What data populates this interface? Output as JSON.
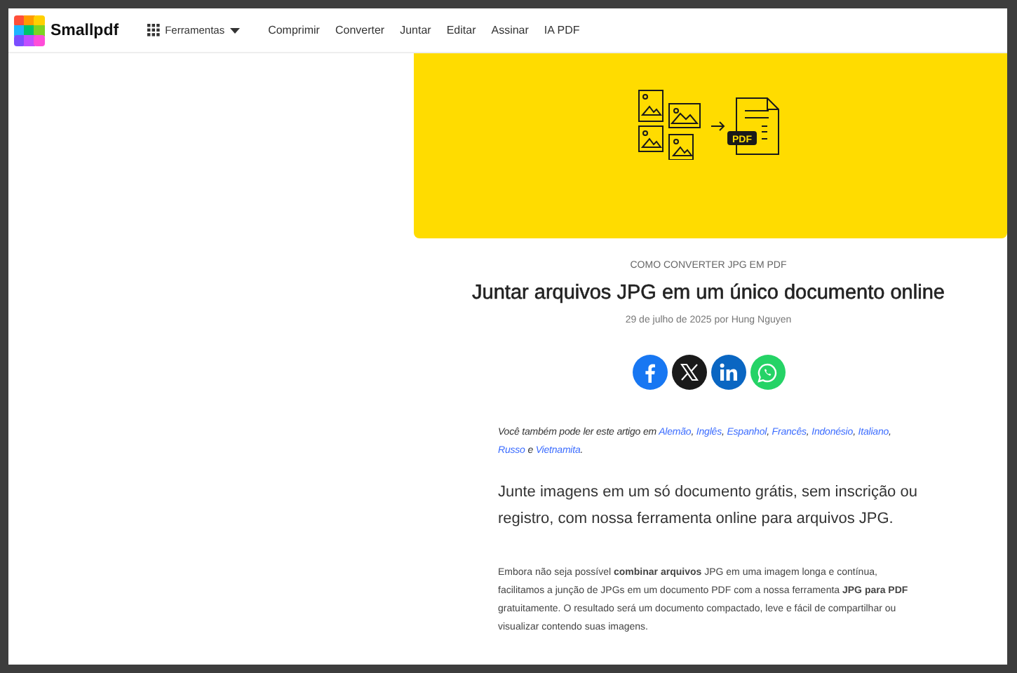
{
  "nav": {
    "logo": "Smallpdf",
    "tools_menu": "Ferramentas",
    "links": [
      "Comprimir",
      "Converter",
      "Juntar",
      "Editar",
      "Assinar",
      "IA PDF"
    ]
  },
  "banner": {
    "badge": "PDF"
  },
  "article": {
    "eyebrow": "COMO CONVERTER JPG EM PDF",
    "title": "Juntar arquivos JPG em um único documento online",
    "byline": "29 de julho de 2025 por Hung Nguyen",
    "share": [
      {
        "kind": "facebook",
        "color": "#1877f2"
      },
      {
        "kind": "x",
        "color": "#1a1a1a"
      },
      {
        "kind": "linkedin",
        "color": "#0a66c2"
      },
      {
        "kind": "whatsapp",
        "color": "#25d366"
      }
    ],
    "languages": [
      {
        "kind": "text",
        "text": "Você também pode ler este artigo em "
      },
      {
        "kind": "link",
        "text": "Alemão"
      },
      {
        "kind": "text",
        "text": ", "
      },
      {
        "kind": "link",
        "text": "Inglês"
      },
      {
        "kind": "text",
        "text": ", "
      },
      {
        "kind": "link",
        "text": "Espanhol"
      },
      {
        "kind": "text",
        "text": ", "
      },
      {
        "kind": "link",
        "text": "Francês"
      },
      {
        "kind": "text",
        "text": ", "
      },
      {
        "kind": "link",
        "text": "Indonésio"
      },
      {
        "kind": "text",
        "text": ", "
      },
      {
        "kind": "link",
        "text": "Italiano"
      },
      {
        "kind": "text",
        "text": ", "
      },
      {
        "kind": "link",
        "text": "Russo"
      },
      {
        "kind": "text",
        "text": " e "
      },
      {
        "kind": "link",
        "text": "Vietnamita"
      },
      {
        "kind": "text",
        "text": "."
      }
    ],
    "lead": "Junte imagens em um só documento grátis, sem inscrição ou registro, com nossa ferramenta online para arquivos JPG.",
    "body": "Embora não seja possível **combinar arquivos** JPG em uma imagem longa e contínua, facilitamos a junção de JPGs em um documento PDF com a nossa ferramenta **JPG para PDF** gratuitamente. O resultado será um documento compactado, leve e fácil de compartilhar ou visualizar contendo suas imagens."
  }
}
